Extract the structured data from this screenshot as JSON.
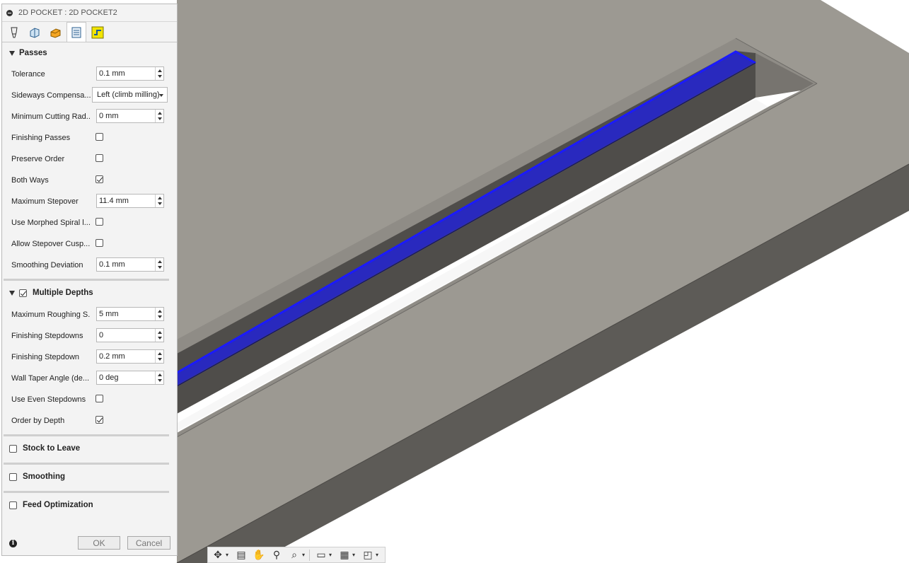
{
  "panel": {
    "title": "2D POCKET : 2D POCKET2",
    "tabs": [
      "tool-icon",
      "geometry-icon",
      "heights-icon",
      "passes-icon",
      "linking-icon"
    ],
    "active_tab": 3,
    "passes": {
      "title": "Passes",
      "tolerance": {
        "label": "Tolerance",
        "value": "0.1 mm"
      },
      "sideways": {
        "label": "Sideways Compensa...",
        "value": "Left (climb milling)"
      },
      "min_radius": {
        "label": "Minimum Cutting Rad...",
        "value": "0 mm"
      },
      "finishing_passes": {
        "label": "Finishing Passes",
        "checked": false
      },
      "preserve_order": {
        "label": "Preserve Order",
        "checked": false
      },
      "both_ways": {
        "label": "Both Ways",
        "checked": true
      },
      "max_stepover": {
        "label": "Maximum Stepover",
        "value": "11.4 mm"
      },
      "morphed_spiral": {
        "label": "Use Morphed Spiral l...",
        "checked": false
      },
      "allow_cusp": {
        "label": "Allow Stepover Cusp...",
        "checked": false
      },
      "smoothing_dev": {
        "label": "Smoothing Deviation",
        "value": "0.1 mm"
      }
    },
    "multiple_depths": {
      "title": "Multiple Depths",
      "checked": true,
      "max_roughing": {
        "label": "Maximum Roughing S...",
        "value": "5 mm"
      },
      "finishing_stepdowns": {
        "label": "Finishing Stepdowns",
        "value": "0"
      },
      "finishing_stepdown": {
        "label": "Finishing Stepdown",
        "value": "0.2 mm"
      },
      "wall_taper": {
        "label": "Wall Taper Angle (de...",
        "value": "0 deg"
      },
      "even_stepdowns": {
        "label": "Use Even Stepdowns",
        "checked": false
      },
      "order_by_depth": {
        "label": "Order by Depth",
        "checked": true
      }
    },
    "stock_to_leave": {
      "title": "Stock to Leave",
      "checked": false
    },
    "smoothing": {
      "title": "Smoothing",
      "checked": false
    },
    "feed_opt": {
      "title": "Feed Optimization",
      "checked": false
    },
    "ok_label": "OK",
    "cancel_label": "Cancel"
  },
  "navbar": {
    "icons": [
      "orbit-icon",
      "look-at-icon",
      "pan-icon",
      "zoom-icon",
      "fit-icon",
      "display-settings-icon",
      "grid-icon",
      "viewports-icon"
    ]
  },
  "colors": {
    "model_top": "#9b9891",
    "model_side": "#5c5a56",
    "toolpath": "#2020e0",
    "accent": "#1a1aff"
  }
}
